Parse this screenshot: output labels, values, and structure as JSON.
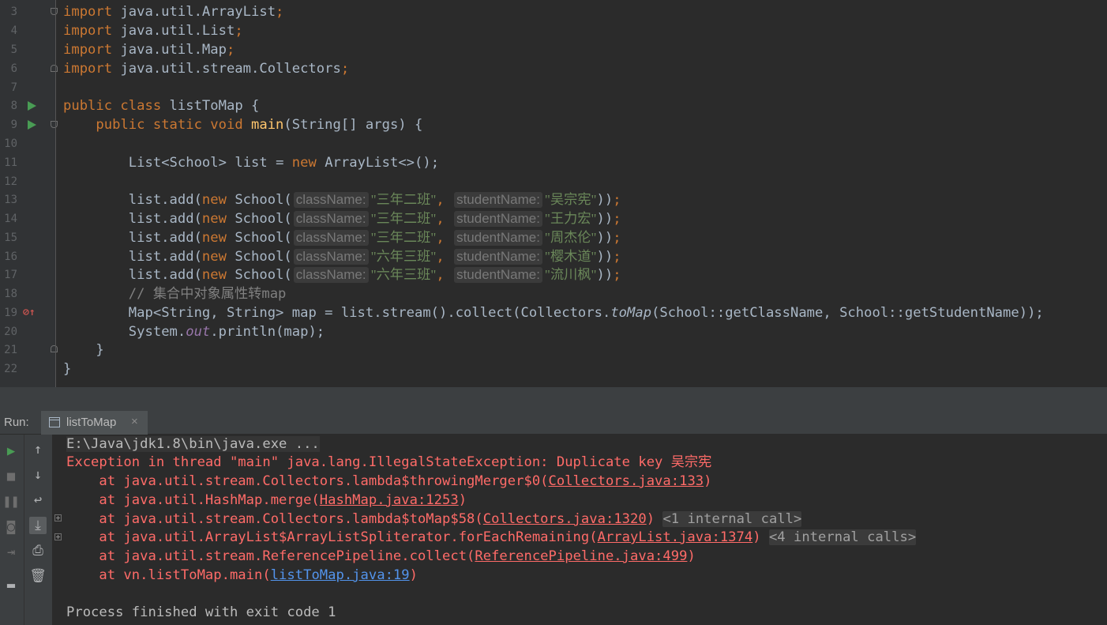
{
  "editor": {
    "line_numbers": [
      "3",
      "4",
      "5",
      "6",
      "7",
      "8",
      "9",
      "10",
      "11",
      "12",
      "13",
      "14",
      "15",
      "16",
      "17",
      "18",
      "19",
      "20",
      "21",
      "22"
    ],
    "imports": [
      "java.util.ArrayList",
      "java.util.List",
      "java.util.Map",
      "java.util.stream.Collectors"
    ],
    "class_name": "listToMap",
    "method_name": "main",
    "params": "(String[] args) {",
    "list_decl": {
      "type": "List<School>",
      "var": "list",
      "impl": "ArrayList<>();"
    },
    "hint_class": "className:",
    "hint_student": "studentName:",
    "add_rows": [
      {
        "cls": "\"三年二班\"",
        "stu": "\"吴宗宪\""
      },
      {
        "cls": "\"三年二班\"",
        "stu": "\"王力宏\""
      },
      {
        "cls": "\"三年二班\"",
        "stu": "\"周杰伦\""
      },
      {
        "cls": "\"六年三班\"",
        "stu": "\"樱木道\""
      },
      {
        "cls": "\"六年三班\"",
        "stu": "\"流川枫\""
      }
    ],
    "comment": "// 集合中对象属性转map",
    "map_line_start": "Map<String, String> map = list.stream().collect(Collectors.",
    "map_line_tomap": "toMap",
    "map_line_end": "(School::getClassName, School::getStudentName));",
    "println_start": "System.",
    "println_out": "out",
    "println_end": ".println(map);"
  },
  "run_panel": {
    "label": "Run:",
    "tab_title": "listToMap",
    "tab_close": "×",
    "cmd": "E:\\Java\\jdk1.8\\bin\\java.exe ...",
    "exception": "Exception in thread \"main\" java.lang.IllegalStateException: Duplicate key 吴宗宪",
    "trace": [
      {
        "pre": "    at java.util.stream.Collectors.lambda$throwingMerger$0(",
        "link": "Collectors.java:133",
        "post": ")",
        "folded": ""
      },
      {
        "pre": "    at java.util.HashMap.merge(",
        "link": "HashMap.java:1253",
        "post": ")",
        "folded": ""
      },
      {
        "pre": "    at java.util.stream.Collectors.lambda$toMap$58(",
        "link": "Collectors.java:1320",
        "post": ")",
        "folded": "<1 internal call>"
      },
      {
        "pre": "    at java.util.ArrayList$ArrayListSpliterator.forEachRemaining(",
        "link": "ArrayList.java:1374",
        "post": ")",
        "folded": "<4 internal calls>"
      },
      {
        "pre": "    at java.util.stream.ReferencePipeline.collect(",
        "link": "ReferencePipeline.java:499",
        "post": ")",
        "folded": ""
      },
      {
        "pre": "    at vn.listToMap.main(",
        "link": "listToMap.java:19",
        "post": ")",
        "folded": ""
      }
    ],
    "finished": "Process finished with exit code 1"
  }
}
